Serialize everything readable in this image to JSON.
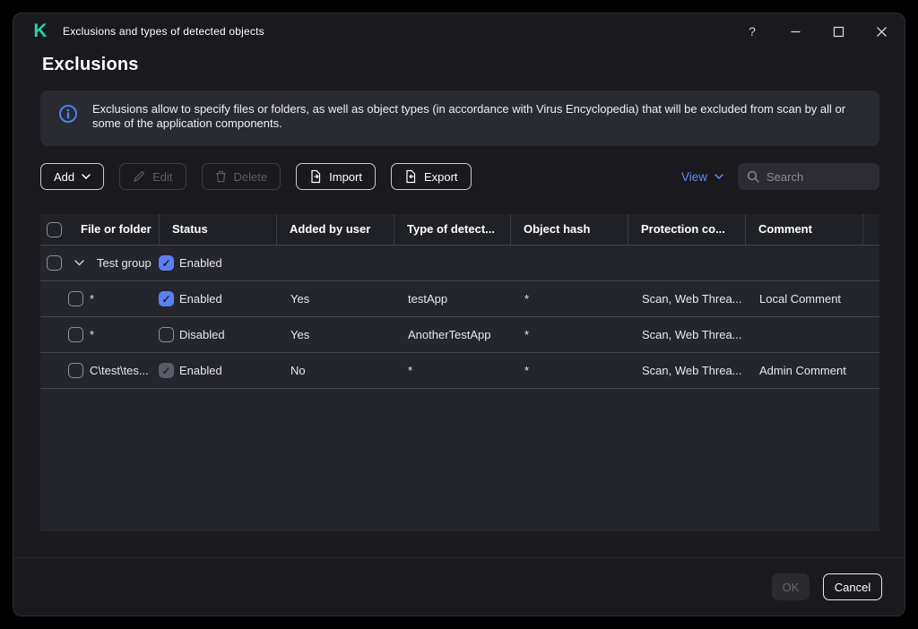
{
  "window": {
    "title": "Exclusions and types of detected objects",
    "controls": {
      "help": "?"
    }
  },
  "page": {
    "heading": "Exclusions"
  },
  "banner": {
    "text": "Exclusions allow to specify files or folders, as well as object types (in accordance with Virus Encyclopedia) that will be excluded from scan by all or some of the application components."
  },
  "toolbar": {
    "add_label": "Add",
    "edit_label": "Edit",
    "delete_label": "Delete",
    "import_label": "Import",
    "export_label": "Export",
    "view_label": "View",
    "search_placeholder": "Search"
  },
  "table": {
    "columns": [
      "File or folder",
      "Status",
      "Added by user",
      "Type of detect...",
      "Object hash",
      "Protection co...",
      "Comment"
    ],
    "group_row": {
      "name": "Test group",
      "status": "Enabled",
      "status_checked": true,
      "expanded": true,
      "selected": false
    },
    "rows": [
      {
        "file": "*",
        "status": "Enabled",
        "status_checked": true,
        "status_editable": true,
        "added": "Yes",
        "type": "testApp",
        "hash": "*",
        "protection": "Scan, Web Threa...",
        "comment": "Local Comment",
        "selected": false
      },
      {
        "file": "*",
        "status": "Disabled",
        "status_checked": false,
        "status_editable": true,
        "added": "Yes",
        "type": "AnotherTestApp",
        "hash": "*",
        "protection": "Scan, Web Threa...",
        "comment": "",
        "selected": false
      },
      {
        "file": "C\\test\\tes...",
        "status": "Enabled",
        "status_checked": true,
        "status_editable": false,
        "added": "No",
        "type": "*",
        "hash": "*",
        "protection": "Scan, Web Threa...",
        "comment": "Admin Comment",
        "selected": false
      }
    ]
  },
  "footer": {
    "ok_label": "OK",
    "cancel_label": "Cancel"
  },
  "icons": {
    "logo_letter": "K"
  },
  "colors": {
    "accent_checkbox_blue": "#5b80f2",
    "link_blue": "#6189f5",
    "info_blue": "#4a82f0",
    "brand_teal": "#27d1a9",
    "panel_dark": "#25262d",
    "window_bg": "#1a1a1e"
  }
}
